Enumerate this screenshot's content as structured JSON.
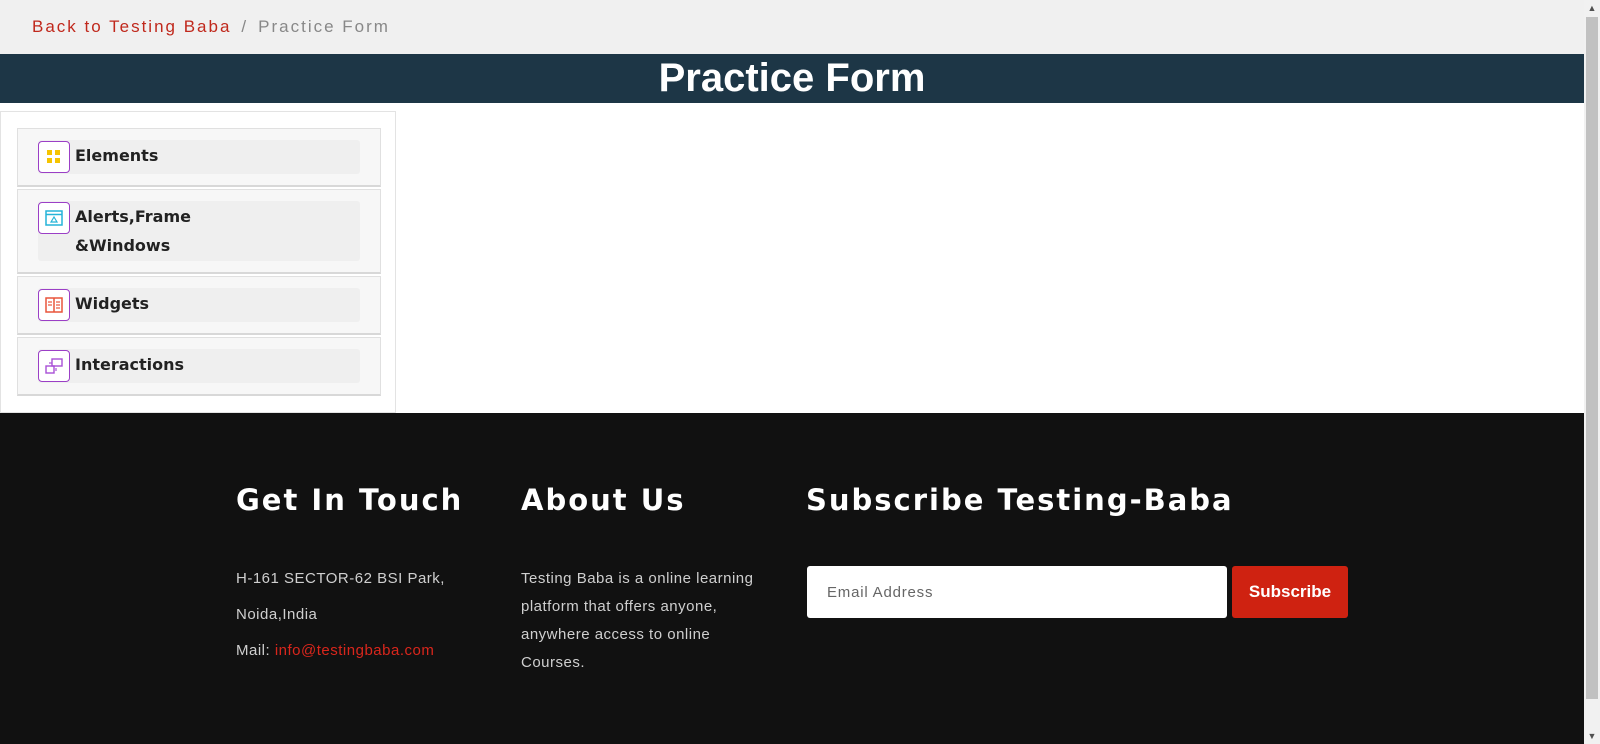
{
  "breadcrumb": {
    "back_link": "Back to Testing Baba",
    "separator": "/",
    "current": "Practice Form"
  },
  "page_title": "Practice Form",
  "sidebar": {
    "items": [
      {
        "label": "Elements",
        "icon": "elements-grid-icon",
        "icon_color": "#f5c400"
      },
      {
        "label": "Alerts,Frame\n   &Windows",
        "icon": "window-icon",
        "icon_color": "#25b4d8"
      },
      {
        "label": "Widgets",
        "icon": "widgets-icon",
        "icon_color": "#e8553b"
      },
      {
        "label": "Interactions",
        "icon": "interactions-icon",
        "icon_color": "#a84fd6"
      }
    ]
  },
  "footer": {
    "contact": {
      "heading": "Get In Touch",
      "address_line1": "H-161 SECTOR-62 BSI Park,",
      "address_line2": "Noida,India",
      "mail_label": "Mail:",
      "mail_value": "info@testingbaba.com"
    },
    "about": {
      "heading": "About Us",
      "text": "Testing Baba is a online learning platform that offers anyone, anywhere access to online Courses."
    },
    "subscribe": {
      "heading": "Subscribe Testing-Baba",
      "email_placeholder": "Email Address",
      "button_label": "Subscribe"
    }
  },
  "colors": {
    "accent_red": "#cf2211",
    "banner": "#1d3646",
    "footer_bg": "#111111",
    "icon_border": "#9b3fc6"
  }
}
